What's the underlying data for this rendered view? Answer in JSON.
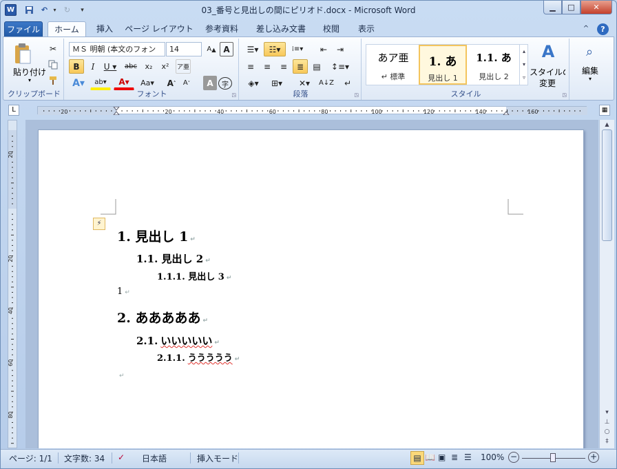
{
  "app": {
    "title": "03_番号と見出しの間にピリオド.docx - Microsoft Word"
  },
  "tabs": [
    "ファイル",
    "ホーム",
    "挿入",
    "ページ レイアウト",
    "参考資料",
    "差し込み文書",
    "校閲",
    "表示"
  ],
  "clipboard": {
    "paste_label": "貼り付け",
    "group_label": "クリップボード"
  },
  "font": {
    "name": "ＭＳ 明朝 (本文のフォン",
    "size": "14",
    "group_label": "フォント"
  },
  "paragraph": {
    "group_label": "段落"
  },
  "styles": {
    "group_label": "スタイル",
    "items": [
      {
        "sample": "あア亜",
        "label": "↵ 標準"
      },
      {
        "sample": "1.  あ",
        "label": "見出し 1"
      },
      {
        "sample": "1.1.  あ",
        "label": "見出し 2"
      }
    ],
    "change_label": "スタイルの変更",
    "change_label_2": "変更"
  },
  "edit": {
    "label": "編集"
  },
  "ruler": {
    "h_ticks": [
      "20",
      "20",
      "40",
      "60",
      "80",
      "100",
      "120",
      "140",
      "160"
    ],
    "v_ticks": [
      "20",
      "20",
      "40",
      "60",
      "80"
    ]
  },
  "document": {
    "lines": [
      {
        "text": "1. 見出し 1",
        "level": 1
      },
      {
        "text": "1.1. 見出し 2",
        "level": 2
      },
      {
        "text": "1.1.1. 見出し 3",
        "level": 3
      },
      {
        "text": "1",
        "level": 0
      },
      {
        "text": "2. あああああ",
        "level": 1
      },
      {
        "num": "2.1.",
        "body": "いいいいい",
        "level": 2
      },
      {
        "num": "2.1.1.",
        "body": "ううううう",
        "level": 3
      },
      {
        "text": "",
        "level": 0
      }
    ]
  },
  "status": {
    "page": "ページ: 1/1",
    "words": "文字数: 34",
    "language": "日本語",
    "mode": "挿入モード",
    "zoom": "100%"
  }
}
